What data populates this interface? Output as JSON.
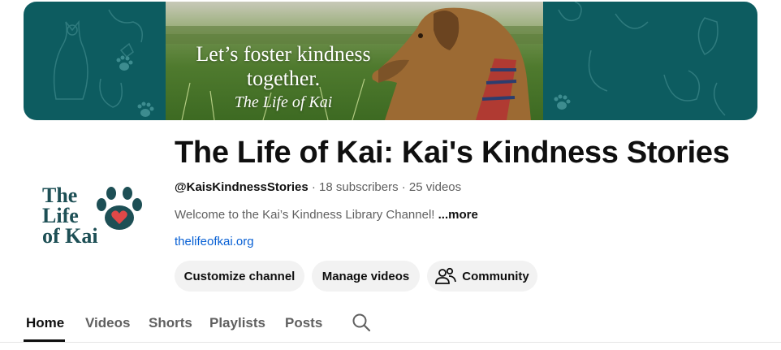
{
  "banner": {
    "line1": "Let’s foster kindness",
    "line2": "together.",
    "script": "The Life of Kai"
  },
  "avatar": {
    "line1": "The",
    "line2": "Life",
    "line3": "of Kai"
  },
  "channel": {
    "title": "The Life of Kai: Kai's Kindness Stories",
    "handle": "@KaisKindnessStories",
    "subscribers": "18 subscribers",
    "videos": "25 videos",
    "separator": " · ",
    "description": "Welcome to the Kai’s Kindness Library Channel!",
    "more": "...more",
    "link": "thelifeofkai.org"
  },
  "buttons": {
    "customize": "Customize channel",
    "manage": "Manage videos",
    "community": "Community"
  },
  "tabs": {
    "home": "Home",
    "videos": "Videos",
    "shorts": "Shorts",
    "playlists": "Playlists",
    "posts": "Posts"
  },
  "colors": {
    "banner_bg": "#0d5c60",
    "brand_teal": "#1d4f55",
    "heart": "#e04848",
    "link": "#065fd4",
    "button_bg": "#f2f2f2"
  },
  "icons": [
    "paw-icon",
    "heart-icon",
    "community-icon",
    "search-icon"
  ]
}
